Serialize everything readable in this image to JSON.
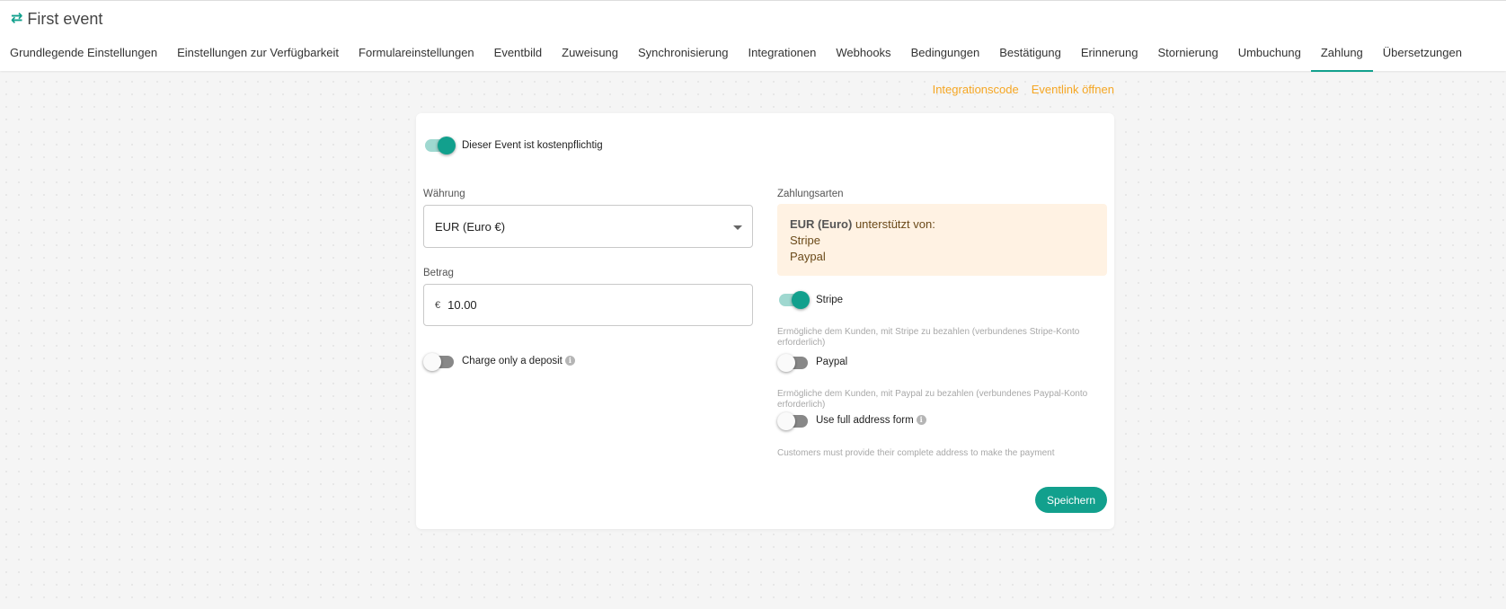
{
  "header": {
    "title_icon": "swap-arrows-icon",
    "title": "First event"
  },
  "tabs": [
    {
      "label": "Grundlegende Einstellungen",
      "active": false
    },
    {
      "label": "Einstellungen zur Verfügbarkeit",
      "active": false
    },
    {
      "label": "Formulareinstellungen",
      "active": false
    },
    {
      "label": "Eventbild",
      "active": false
    },
    {
      "label": "Zuweisung",
      "active": false
    },
    {
      "label": "Synchronisierung",
      "active": false
    },
    {
      "label": "Integrationen",
      "active": false
    },
    {
      "label": "Webhooks",
      "active": false
    },
    {
      "label": "Bedingungen",
      "active": false
    },
    {
      "label": "Bestätigung",
      "active": false
    },
    {
      "label": "Erinnerung",
      "active": false
    },
    {
      "label": "Stornierung",
      "active": false
    },
    {
      "label": "Umbuchung",
      "active": false
    },
    {
      "label": "Zahlung",
      "active": true
    },
    {
      "label": "Übersetzungen",
      "active": false
    }
  ],
  "links": {
    "integration_code": "Integrationscode",
    "open_event_link": "Eventlink öffnen"
  },
  "payment": {
    "paid_toggle_label": "Dieser Event ist kostenpflichtig",
    "paid_enabled": true,
    "currency_label": "Währung",
    "currency_value": "EUR (Euro €)",
    "amount_label": "Betrag",
    "amount_prefix": "€",
    "amount_value": "10.00",
    "deposit_label": "Charge only a deposit",
    "deposit_enabled": false,
    "methods_label": "Zahlungsarten",
    "notice_currency": "EUR (Euro)",
    "notice_suffix": " unterstützt von:",
    "notice_providers": [
      "Stripe",
      "Paypal"
    ],
    "stripe_label": "Stripe",
    "stripe_enabled": true,
    "stripe_hint": "Ermögliche dem Kunden, mit Stripe zu bezahlen (verbundenes Stripe-Konto erforderlich)",
    "paypal_label": "Paypal",
    "paypal_enabled": false,
    "paypal_hint": "Ermögliche dem Kunden, mit Paypal zu bezahlen (verbundenes Paypal-Konto erforderlich)",
    "address_label": "Use full address form",
    "address_enabled": false,
    "address_hint": "Customers must provide their complete address to make the payment",
    "save_label": "Speichern"
  },
  "colors": {
    "accent": "#12a08d",
    "link": "#f5a623",
    "notice_bg": "#fff2e3"
  }
}
